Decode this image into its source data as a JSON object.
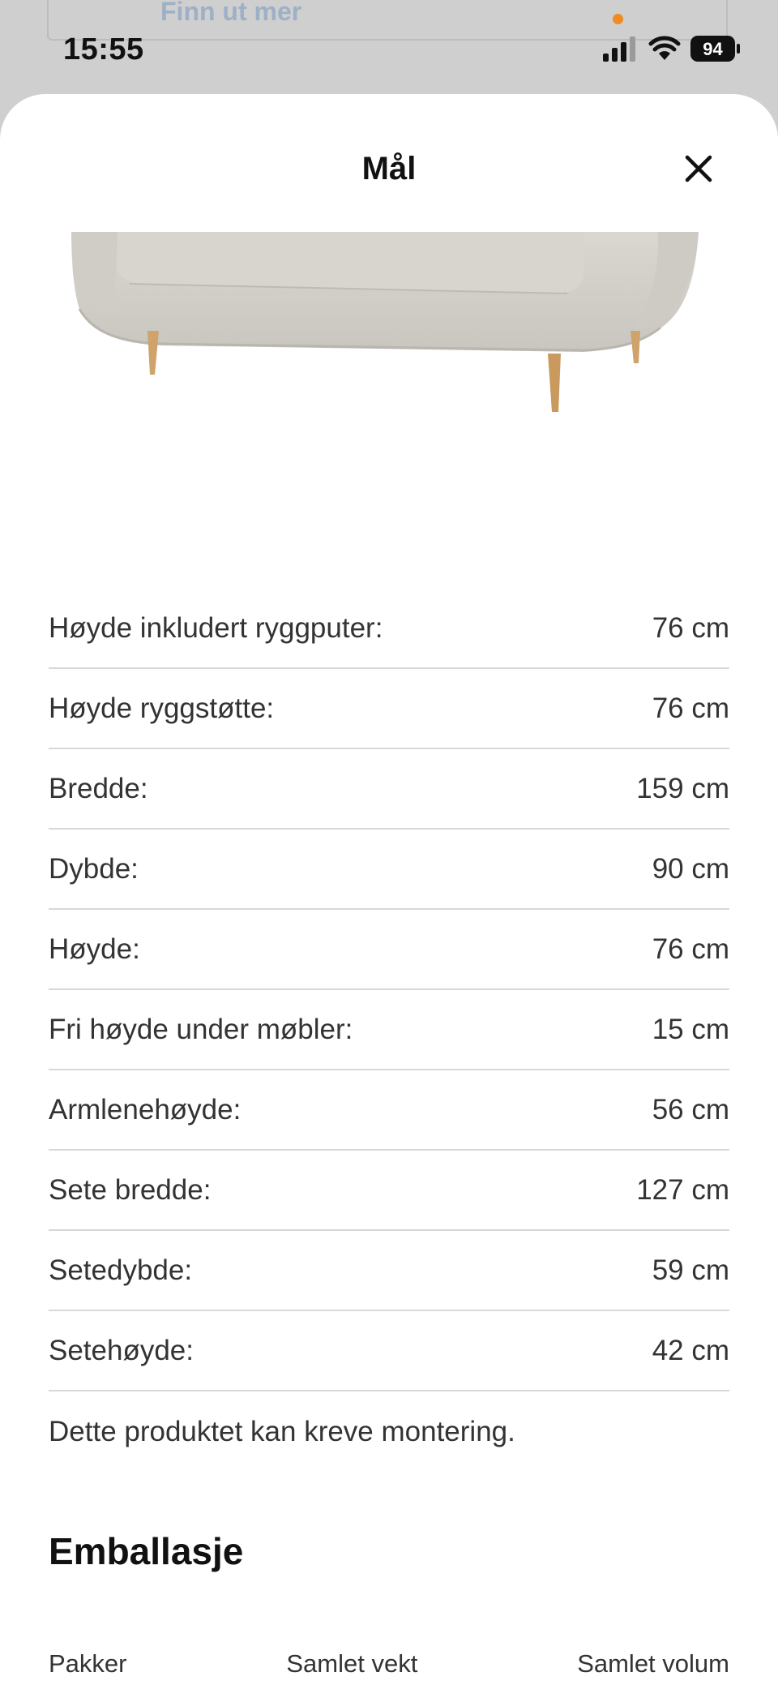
{
  "background_link": {
    "label": "Finn ut mer"
  },
  "status_bar": {
    "time": "15:55",
    "battery": "94"
  },
  "sheet": {
    "title": "Mål",
    "close_icon": "close-icon"
  },
  "dimensions": [
    {
      "label": "Høyde inkludert ryggputer:",
      "value": "76 cm"
    },
    {
      "label": "Høyde ryggstøtte:",
      "value": "76 cm"
    },
    {
      "label": "Bredde:",
      "value": "159 cm"
    },
    {
      "label": "Dybde:",
      "value": "90 cm"
    },
    {
      "label": "Høyde:",
      "value": "76 cm"
    },
    {
      "label": "Fri høyde under møbler:",
      "value": "15 cm"
    },
    {
      "label": "Armlenehøyde:",
      "value": "56 cm"
    },
    {
      "label": "Sete bredde:",
      "value": "127 cm"
    },
    {
      "label": "Setedybde:",
      "value": "59 cm"
    },
    {
      "label": "Setehøyde:",
      "value": "42 cm"
    }
  ],
  "assembly_note": "Dette produktet kan kreve montering.",
  "packaging": {
    "heading": "Emballasje",
    "columns": [
      "Pakker",
      "Samlet vekt",
      "Samlet volum"
    ]
  },
  "colors": {
    "sheet_bg": "#ffffff",
    "backdrop": "#cfcfcf",
    "divider": "#d8d8d8",
    "status_dot": "#f08a24"
  }
}
